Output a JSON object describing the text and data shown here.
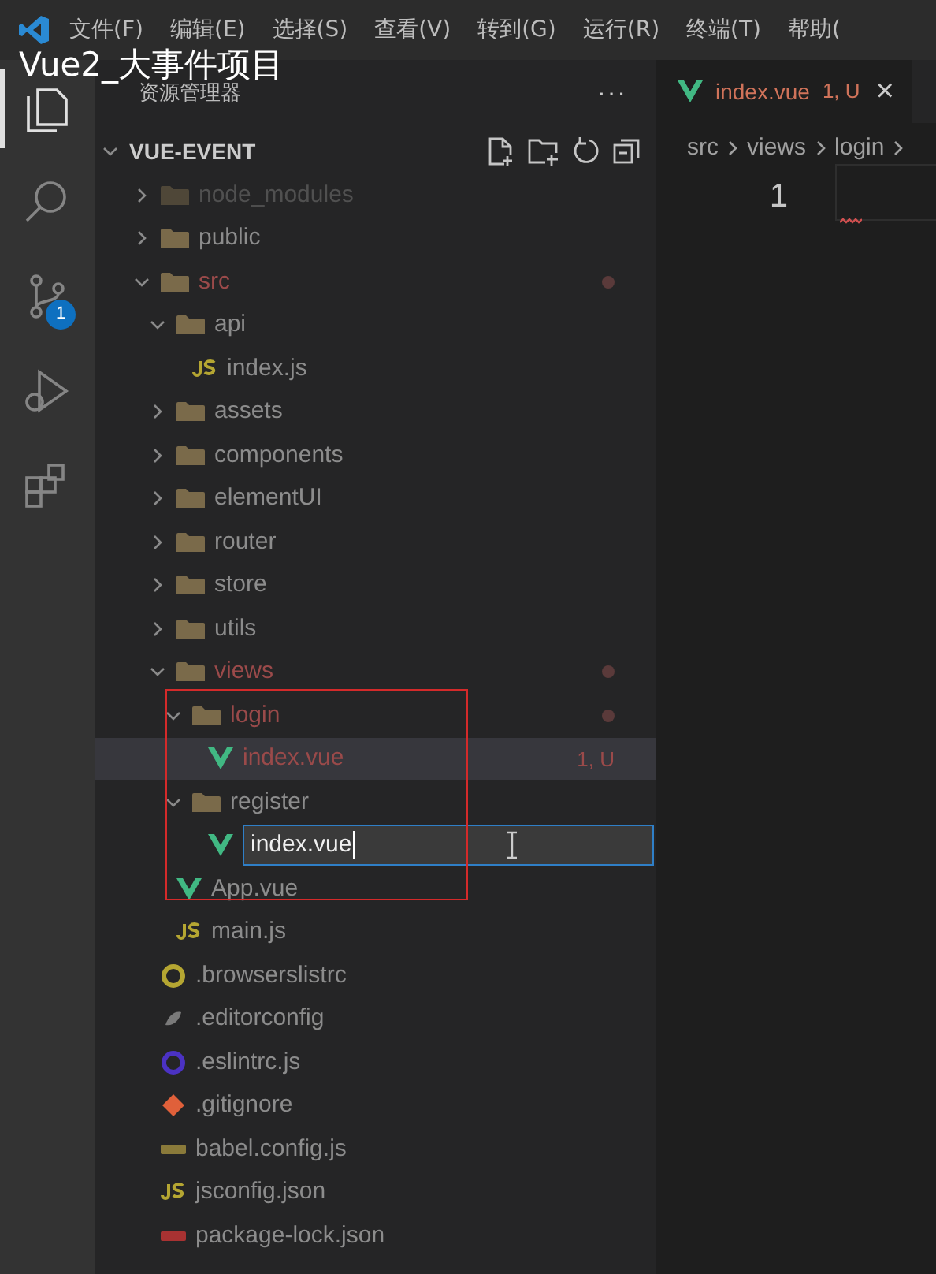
{
  "title_overlay": "Vue2_大事件项目",
  "menu": [
    "文件(F)",
    "编辑(E)",
    "选择(S)",
    "查看(V)",
    "转到(G)",
    "运行(R)",
    "终端(T)",
    "帮助("
  ],
  "activity_bar": [
    {
      "kind": "files",
      "selected": true
    },
    {
      "kind": "search",
      "selected": false
    },
    {
      "kind": "source_control",
      "selected": false,
      "badge": "1"
    },
    {
      "kind": "run",
      "selected": false
    },
    {
      "kind": "extensions",
      "selected": false
    }
  ],
  "sidebar": {
    "title": "资源管理器",
    "more": "···",
    "project": {
      "name": "VUE-EVENT",
      "expanded": true
    },
    "tree": [
      {
        "name": "node_modules",
        "kind": "folder",
        "expanded": false,
        "ignored": true,
        "modified": false,
        "selected": false
      },
      {
        "name": "public",
        "kind": "folder",
        "expanded": false,
        "ignored": false,
        "modified": false,
        "selected": false
      },
      {
        "name": "src",
        "kind": "folder",
        "expanded": true,
        "ignored": false,
        "modified": true,
        "selected": false,
        "children": [
          {
            "name": "api",
            "kind": "folder",
            "expanded": true,
            "ignored": false,
            "modified": false,
            "selected": false,
            "children": [
              {
                "name": "index.js",
                "kind": "js",
                "ignored": false,
                "modified": false,
                "selected": false
              }
            ]
          },
          {
            "name": "assets",
            "kind": "folder",
            "expanded": false,
            "ignored": false,
            "modified": false,
            "selected": false
          },
          {
            "name": "components",
            "kind": "folder",
            "expanded": false,
            "ignored": false,
            "modified": false,
            "selected": false
          },
          {
            "name": "elementUI",
            "kind": "folder",
            "expanded": false,
            "ignored": false,
            "modified": false,
            "selected": false
          },
          {
            "name": "router",
            "kind": "folder",
            "expanded": false,
            "ignored": false,
            "modified": false,
            "selected": false
          },
          {
            "name": "store",
            "kind": "folder",
            "expanded": false,
            "ignored": false,
            "modified": false,
            "selected": false
          },
          {
            "name": "utils",
            "kind": "folder",
            "expanded": false,
            "ignored": false,
            "modified": false,
            "selected": false
          },
          {
            "name": "views",
            "kind": "folder",
            "expanded": true,
            "ignored": false,
            "modified": true,
            "selected": false,
            "children": [
              {
                "name": "login",
                "kind": "folder",
                "expanded": true,
                "ignored": false,
                "modified": true,
                "selected": false,
                "children": [
                  {
                    "name": "index.vue",
                    "kind": "vue",
                    "ignored": false,
                    "modified": true,
                    "selected": true,
                    "status": "1, U"
                  }
                ]
              },
              {
                "name": "register",
                "kind": "folder",
                "expanded": true,
                "ignored": false,
                "modified": false,
                "selected": false,
                "children": [
                  {
                    "name": "index.vue",
                    "kind": "rename",
                    "ignored": false,
                    "modified": false,
                    "selected": false
                  }
                ]
              }
            ]
          },
          {
            "name": "App.vue",
            "kind": "vue",
            "ignored": false,
            "modified": false,
            "selected": false
          },
          {
            "name": "main.js",
            "kind": "js",
            "ignored": false,
            "modified": false,
            "selected": false
          }
        ]
      },
      {
        "name": ".browserslistrc",
        "kind": "rc",
        "ignored": false,
        "modified": false,
        "selected": false
      },
      {
        "name": ".editorconfig",
        "kind": "config",
        "ignored": false,
        "modified": false,
        "selected": false
      },
      {
        "name": ".eslintrc.js",
        "kind": "eslint",
        "ignored": false,
        "modified": false,
        "selected": false
      },
      {
        "name": ".gitignore",
        "kind": "git",
        "ignored": false,
        "modified": false,
        "selected": false
      },
      {
        "name": "babel.config.js",
        "kind": "babel",
        "ignored": false,
        "modified": false,
        "selected": false
      },
      {
        "name": "jsconfig.json",
        "kind": "js",
        "ignored": false,
        "modified": false,
        "selected": false
      },
      {
        "name": "package-lock.json",
        "kind": "npm",
        "ignored": false,
        "modified": false,
        "selected": false
      }
    ]
  },
  "annotation_box": true,
  "editor": {
    "tab": {
      "label": "index.vue",
      "status": "1, U",
      "close": "×"
    },
    "breadcrumbs": [
      "src",
      "views",
      "login"
    ],
    "line_numbers": [
      "1"
    ]
  }
}
